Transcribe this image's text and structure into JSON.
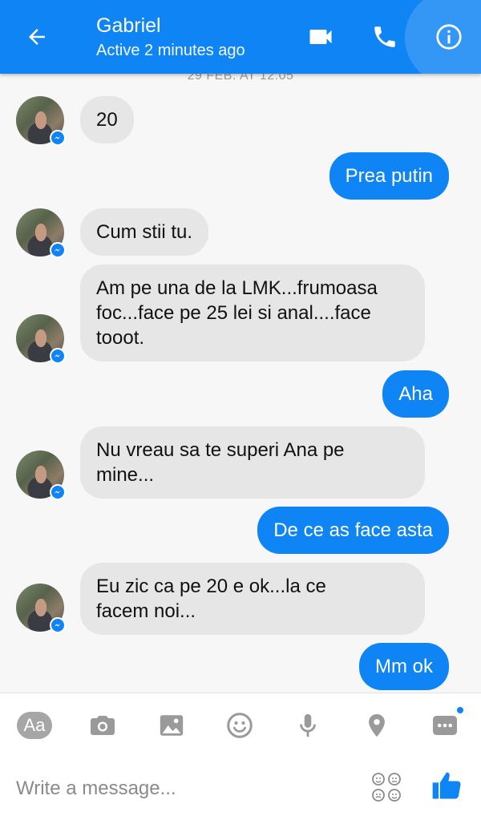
{
  "header": {
    "title": "Gabriel",
    "status": "Active 2 minutes ago",
    "bg_color": "#0e84f5",
    "icons": [
      "back-arrow-icon",
      "video-camera-icon",
      "phone-icon",
      "info-icon"
    ]
  },
  "conversation": {
    "date_separator": "29 FEB. AT 12:05",
    "messages": [
      {
        "from": "contact",
        "text": "20"
      },
      {
        "from": "me",
        "text": "Prea putin"
      },
      {
        "from": "contact",
        "text": "Cum stii tu."
      },
      {
        "from": "contact",
        "text": "Am pe una de la LMK...frumoasa\nfoc...face pe 25 lei si anal....face\ntooot."
      },
      {
        "from": "me",
        "text": "Aha"
      },
      {
        "from": "contact",
        "text": "Nu vreau sa te superi Ana pe\nmine..."
      },
      {
        "from": "me",
        "text": "De ce as face asta"
      },
      {
        "from": "contact",
        "text": "Eu zic ca pe 20 e ok...la ce\nfacem noi..."
      },
      {
        "from": "me",
        "text": "Mm ok"
      }
    ],
    "incoming_bubble_color": "#e6e6e6",
    "outgoing_bubble_color": "#0e84f5"
  },
  "toolbar": {
    "aa_label": "Aa",
    "icons": [
      "text-format-icon",
      "camera-icon",
      "image-icon",
      "emoji-icon",
      "microphone-icon",
      "location-pin-icon",
      "more-icon"
    ]
  },
  "composer": {
    "placeholder": "Write a message...",
    "icons": [
      "sticker-icon",
      "thumbs-up-icon"
    ]
  }
}
